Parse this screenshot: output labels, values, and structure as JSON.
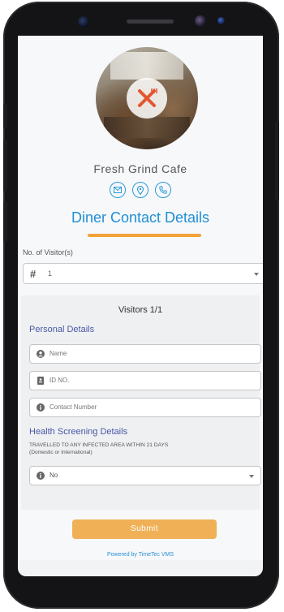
{
  "cafe": {
    "name": "Fresh Grind Cafe"
  },
  "page": {
    "title": "Diner Contact Details"
  },
  "visitors": {
    "label": "No. of Visitor(s)",
    "selected": "1",
    "card_title": "Visitors 1/1"
  },
  "personal": {
    "heading": "Personal Details",
    "name_placeholder": "Name",
    "id_placeholder": "ID NO.",
    "contact_placeholder": "Contact Number"
  },
  "health": {
    "heading": "Health Screening Details",
    "question_line1": "TRAVELLED TO ANY INFECTED AREA WITHIN 21 DAYS",
    "question_line2": "(Domestic or International)",
    "answer": "No"
  },
  "actions": {
    "submit_label": "Submit"
  },
  "footer": {
    "powered_by": "Powered by TimeTec VMS"
  },
  "colors": {
    "accent_blue": "#1f8fd4",
    "accent_orange": "#f0b056",
    "section_purple": "#4a57a6"
  },
  "icons": {
    "contact": [
      "email-icon",
      "location-pin-icon",
      "phone-icon"
    ],
    "fields": [
      "user-icon",
      "id-card-icon",
      "info-icon",
      "info-icon"
    ]
  }
}
